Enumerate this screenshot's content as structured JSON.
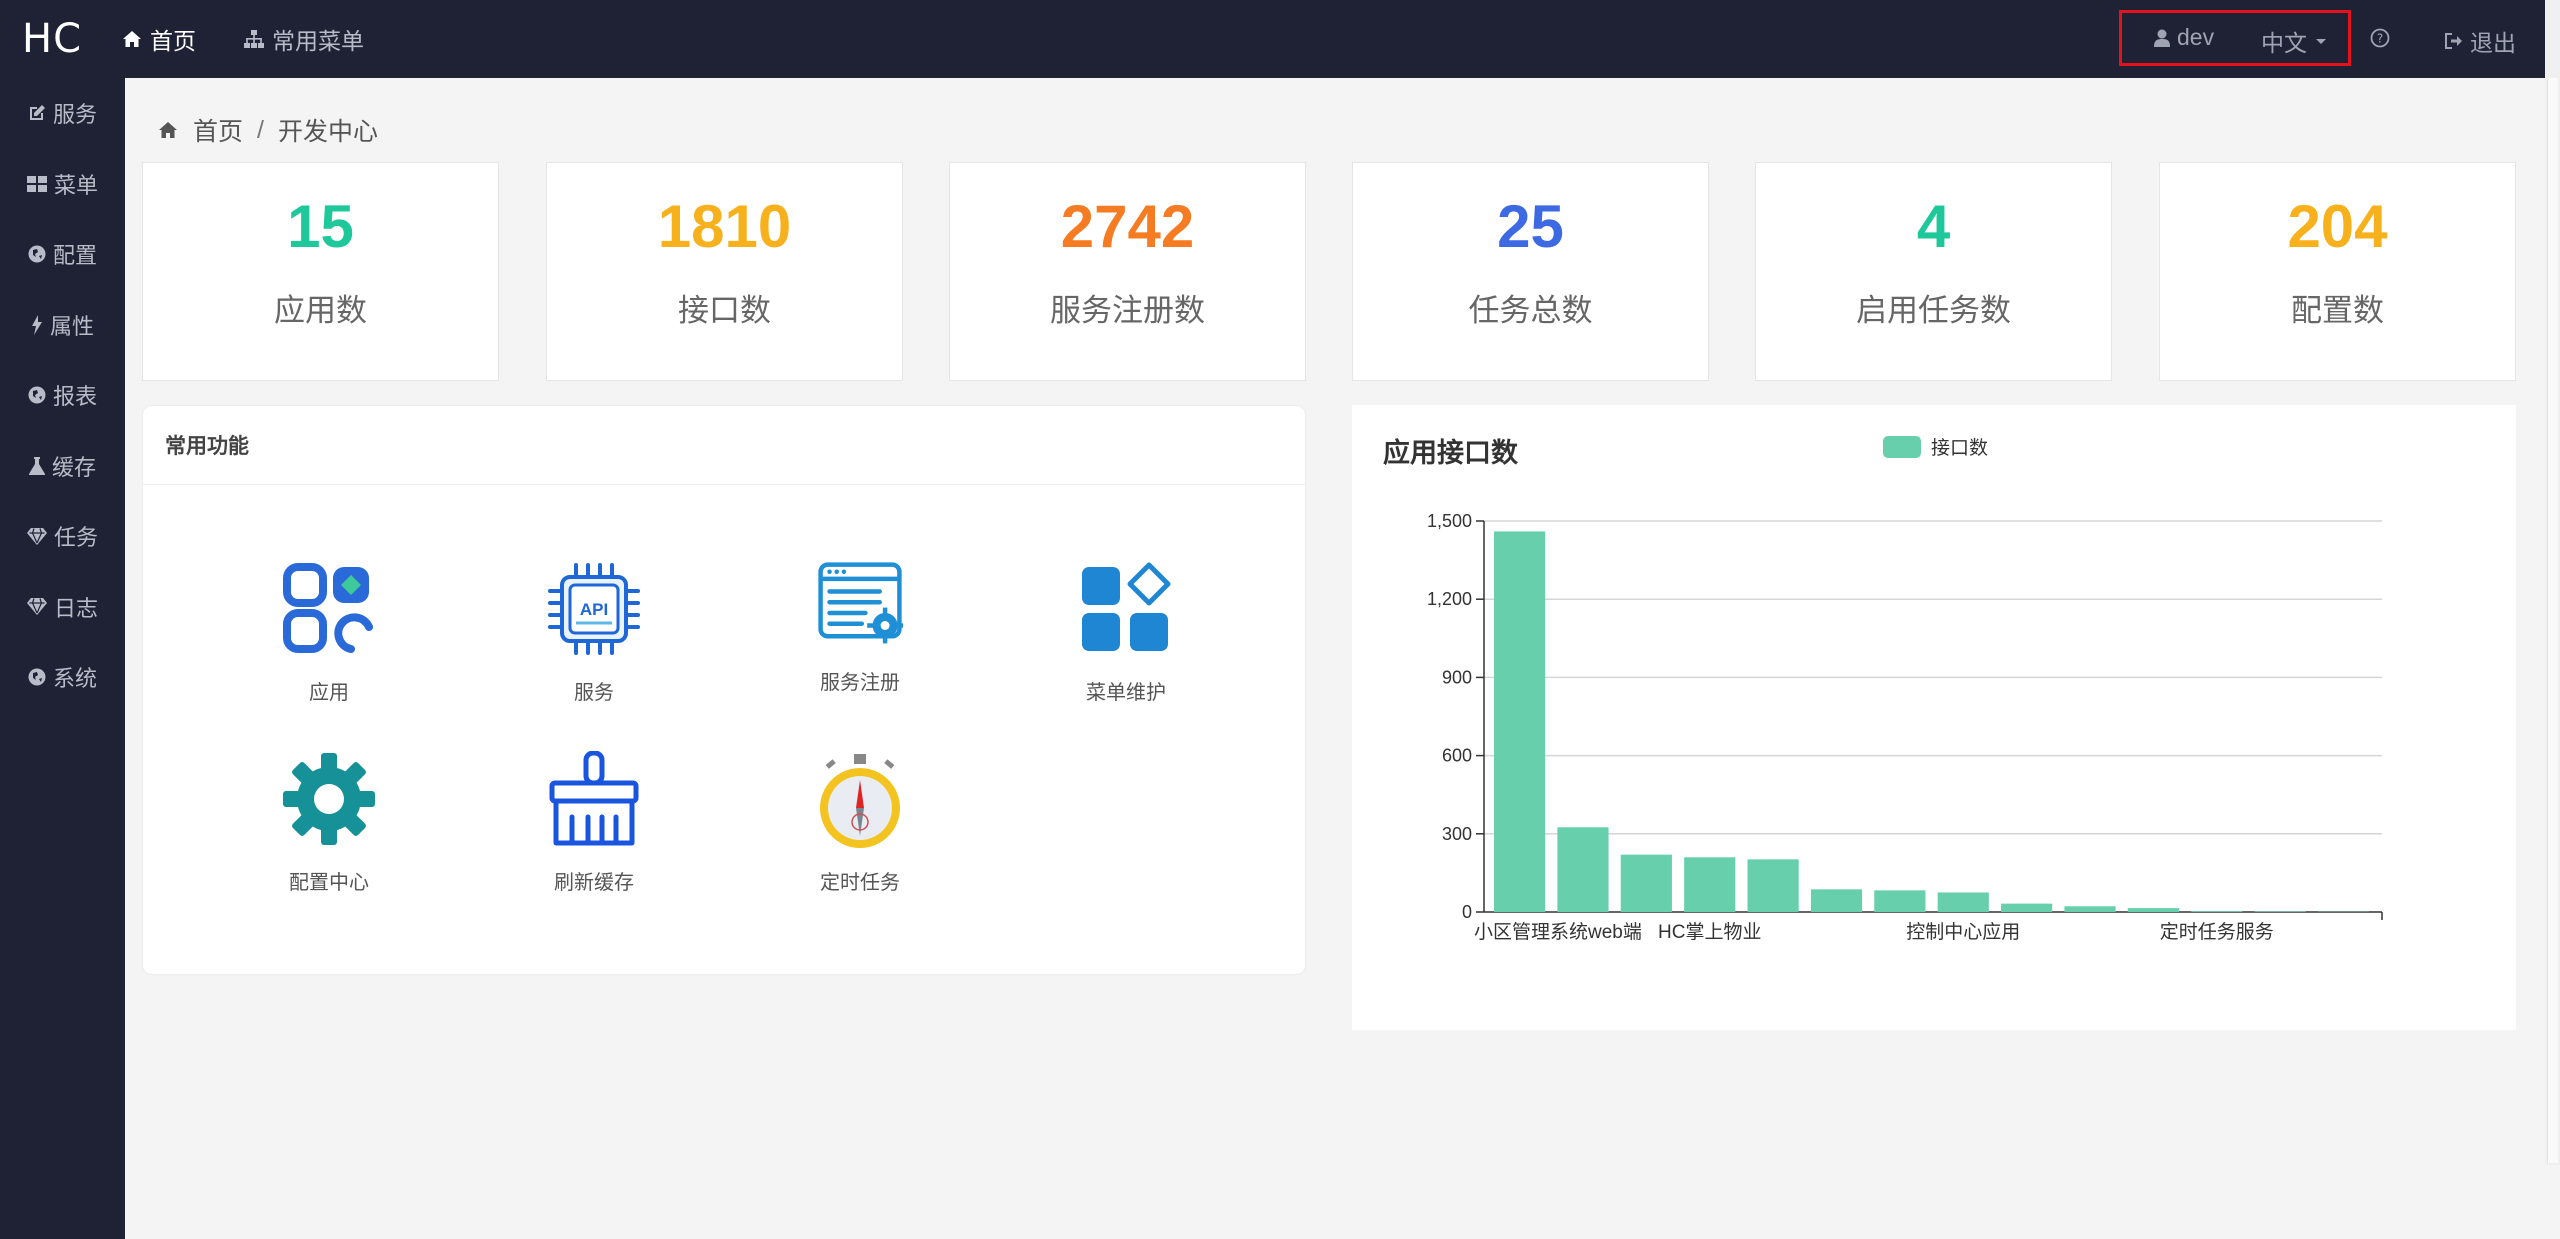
{
  "brand": "HC",
  "topnav": {
    "home": "首页",
    "common_menu": "常用菜单"
  },
  "topright": {
    "user": "dev",
    "language": "中文",
    "logout": "退出"
  },
  "sidebar": {
    "items": [
      {
        "label": "服务",
        "icon": "edit-icon"
      },
      {
        "label": "菜单",
        "icon": "grid-icon"
      },
      {
        "label": "配置",
        "icon": "globe-icon"
      },
      {
        "label": "属性",
        "icon": "bolt-icon"
      },
      {
        "label": "报表",
        "icon": "globe-icon"
      },
      {
        "label": "缓存",
        "icon": "flask-icon"
      },
      {
        "label": "任务",
        "icon": "diamond-icon"
      },
      {
        "label": "日志",
        "icon": "diamond-icon"
      },
      {
        "label": "系统",
        "icon": "globe-icon"
      }
    ]
  },
  "breadcrumb": {
    "home": "首页",
    "separator": "/",
    "current": "开发中心"
  },
  "stats": [
    {
      "value": "15",
      "label": "应用数",
      "color": "#1fc89b"
    },
    {
      "value": "1810",
      "label": "接口数",
      "color": "#f7b11d"
    },
    {
      "value": "2742",
      "label": "服务注册数",
      "color": "#f57c23"
    },
    {
      "value": "25",
      "label": "任务总数",
      "color": "#3d6ae3"
    },
    {
      "value": "4",
      "label": "启用任务数",
      "color": "#1fc89b"
    },
    {
      "value": "204",
      "label": "配置数",
      "color": "#f7b11d"
    }
  ],
  "functions": {
    "title": "常用功能",
    "items": [
      {
        "label": "应用",
        "icon": "apps-icon"
      },
      {
        "label": "服务",
        "icon": "api-chip-icon"
      },
      {
        "label": "服务注册",
        "icon": "register-window-icon"
      },
      {
        "label": "菜单维护",
        "icon": "menu-blocks-icon"
      },
      {
        "label": "配置中心",
        "icon": "gear-icon"
      },
      {
        "label": "刷新缓存",
        "icon": "brush-icon"
      },
      {
        "label": "定时任务",
        "icon": "stopwatch-icon"
      }
    ]
  },
  "chart_data": {
    "type": "bar",
    "title": "应用接口数",
    "legend": "接口数",
    "legend_position": "top",
    "color": "#68cfad",
    "ylim": [
      0,
      1500
    ],
    "yticks": [
      "0",
      "300",
      "600",
      "900",
      "1,200",
      "1,500"
    ],
    "grid": true,
    "categories": [
      "小区管理系统web端",
      "",
      "",
      "HC掌上物业",
      "",
      "",
      "",
      "控制中心应用",
      "",
      "",
      "",
      "定时任务服务",
      "",
      ""
    ],
    "values": [
      1460,
      325,
      220,
      210,
      202,
      87,
      83,
      75,
      32,
      22,
      15,
      3,
      2,
      1
    ]
  }
}
